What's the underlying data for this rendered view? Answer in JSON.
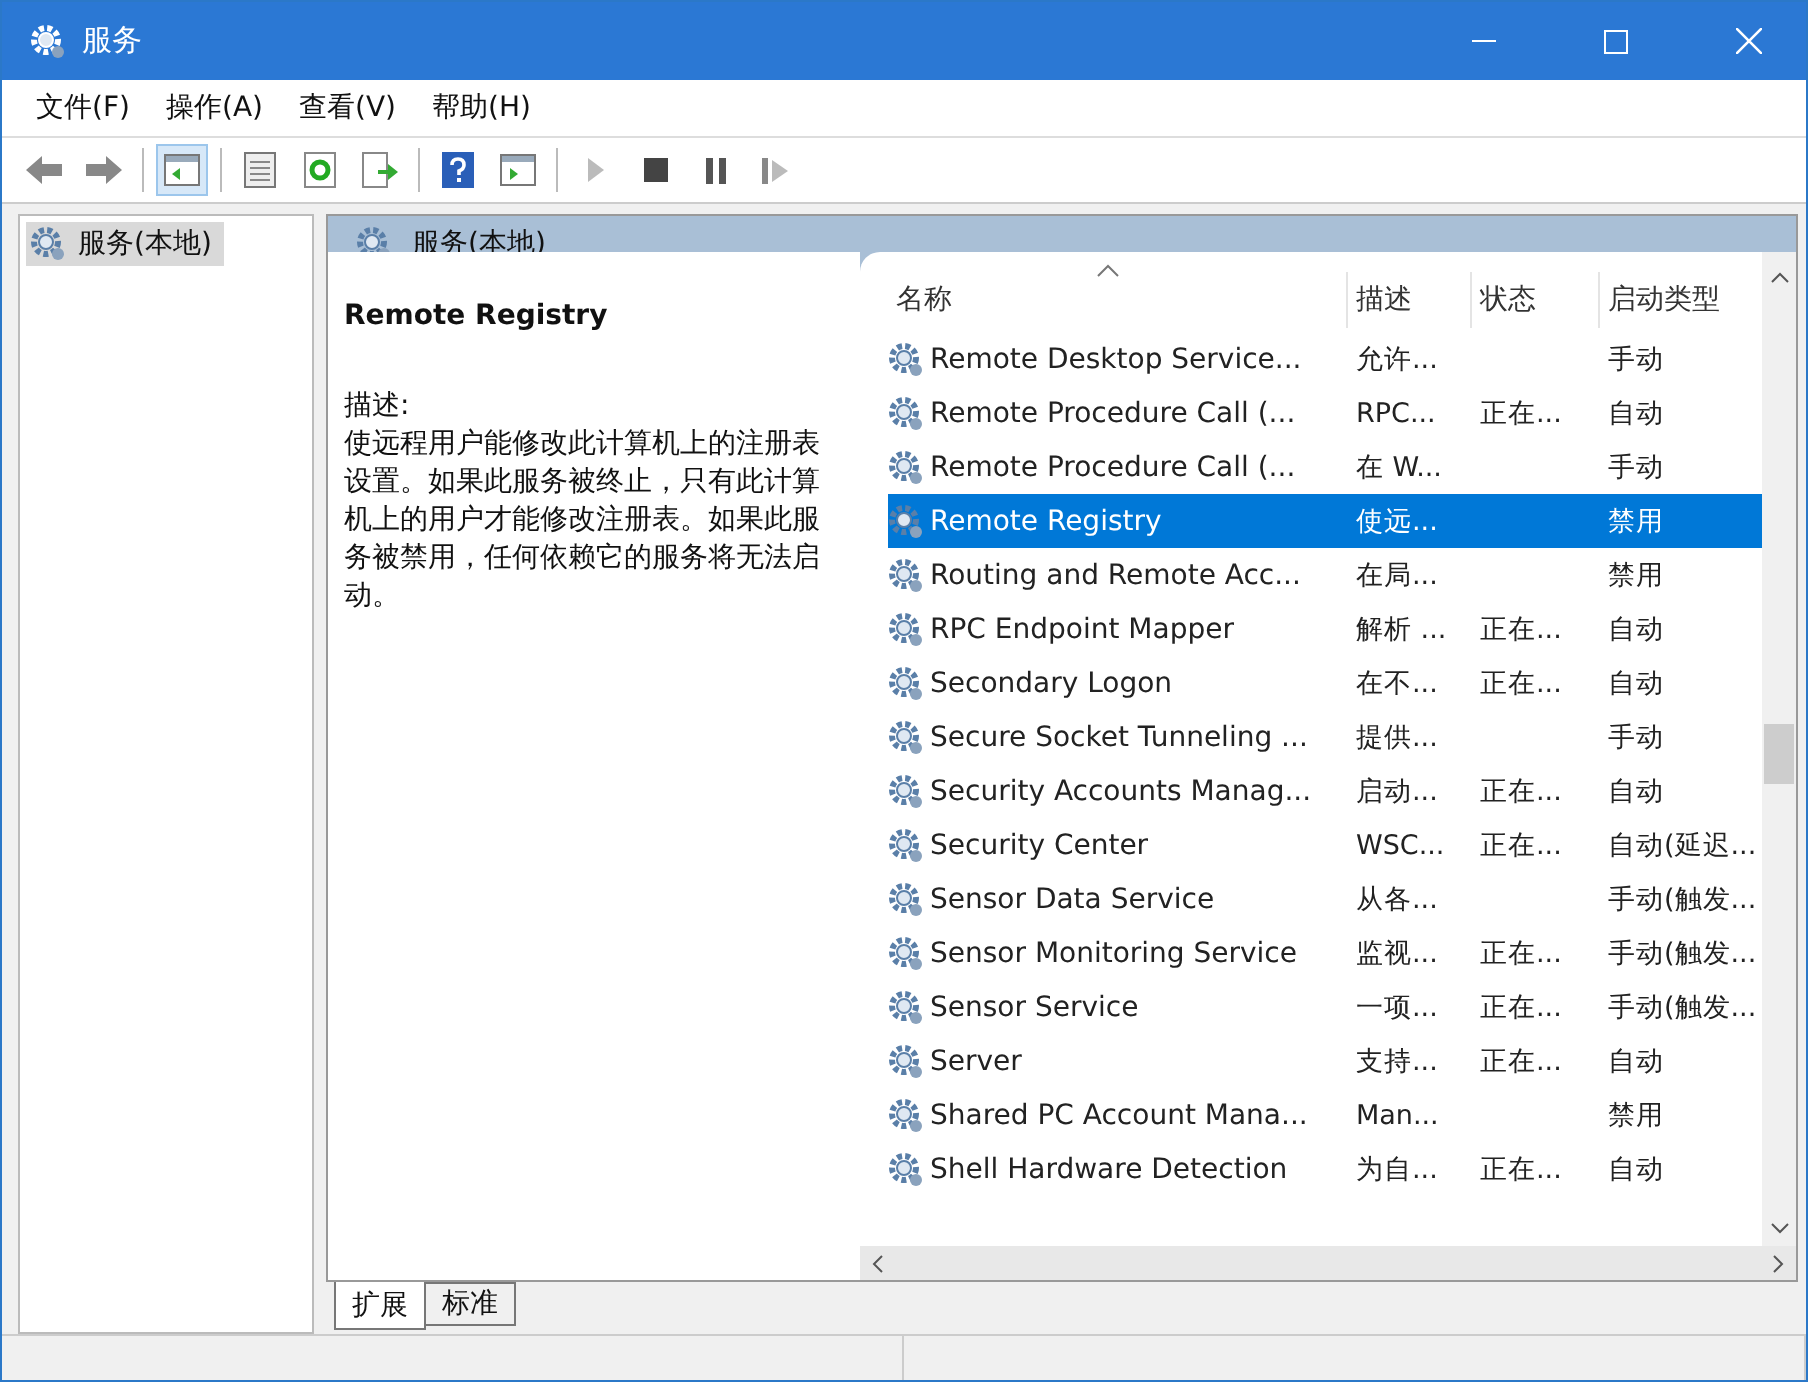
{
  "window": {
    "title": "服务"
  },
  "menu": [
    "文件(F)",
    "操作(A)",
    "查看(V)",
    "帮助(H)"
  ],
  "toolbar": [
    [
      {
        "kind": "back"
      },
      {
        "kind": "forward"
      }
    ],
    [
      {
        "kind": "tree",
        "pressed": true
      }
    ],
    [
      {
        "kind": "properties"
      },
      {
        "kind": "refresh"
      },
      {
        "kind": "export"
      }
    ],
    [
      {
        "kind": "help"
      },
      {
        "kind": "actionpane"
      }
    ],
    [
      {
        "kind": "play"
      },
      {
        "kind": "stop"
      },
      {
        "kind": "pause"
      },
      {
        "kind": "resume"
      }
    ]
  ],
  "tree": {
    "items": [
      {
        "label": "服务(本地)",
        "selected": true
      }
    ]
  },
  "panel": {
    "title": "服务(本地)",
    "service_name": "Remote Registry",
    "description_label": "描述:",
    "description": "使远程用户能修改此计算机上的注册表设置。如果此服务被终止，只有此计算机上的用户才能修改注册表。如果此服务被禁用，任何依赖它的服务将无法启动。"
  },
  "table": {
    "columns": [
      "名称",
      "描述",
      "状态",
      "启动类型"
    ],
    "rows": [
      {
        "name": "Remote Desktop Service...",
        "description": "允许...",
        "startup": "手动",
        "selected": false
      },
      {
        "name": "Remote Procedure Call (...",
        "description": "RPC...",
        "status": "正在...",
        "startup": "自动",
        "selected": false
      },
      {
        "name": "Remote Procedure Call (...",
        "description": "在 W...",
        "startup": "手动",
        "selected": false
      },
      {
        "name": "Remote Registry",
        "description": "使远...",
        "startup": "禁用",
        "selected": true
      },
      {
        "name": "Routing and Remote Acc...",
        "description": "在局...",
        "startup": "禁用",
        "selected": false
      },
      {
        "name": "RPC Endpoint Mapper",
        "description": "解析 ...",
        "status": "正在...",
        "startup": "自动",
        "selected": false
      },
      {
        "name": "Secondary Logon",
        "description": "在不...",
        "status": "正在...",
        "startup": "自动",
        "selected": false
      },
      {
        "name": "Secure Socket Tunneling ...",
        "description": "提供...",
        "startup": "手动",
        "selected": false
      },
      {
        "name": "Security Accounts Manag...",
        "description": "启动...",
        "status": "正在...",
        "startup": "自动",
        "selected": false
      },
      {
        "name": "Security Center",
        "description": "WSC...",
        "status": "正在...",
        "startup": "自动(延迟...",
        "selected": false
      },
      {
        "name": "Sensor Data Service",
        "description": "从各...",
        "startup": "手动(触发...",
        "selected": false
      },
      {
        "name": "Sensor Monitoring Service",
        "description": "监视...",
        "status": "正在...",
        "startup": "手动(触发...",
        "selected": false
      },
      {
        "name": "Sensor Service",
        "description": "一项...",
        "status": "正在...",
        "startup": "手动(触发...",
        "selected": false
      },
      {
        "name": "Server",
        "description": "支持...",
        "status": "正在...",
        "startup": "自动",
        "selected": false
      },
      {
        "name": "Shared PC Account Mana...",
        "description": "Man...",
        "startup": "禁用",
        "selected": false
      },
      {
        "name": "Shell Hardware Detection",
        "description": "为自...",
        "status": "正在...",
        "startup": "自动",
        "selected": false
      }
    ]
  },
  "tabs": [
    {
      "label": "扩展",
      "selected": true
    },
    {
      "label": "标准",
      "selected": false
    }
  ]
}
